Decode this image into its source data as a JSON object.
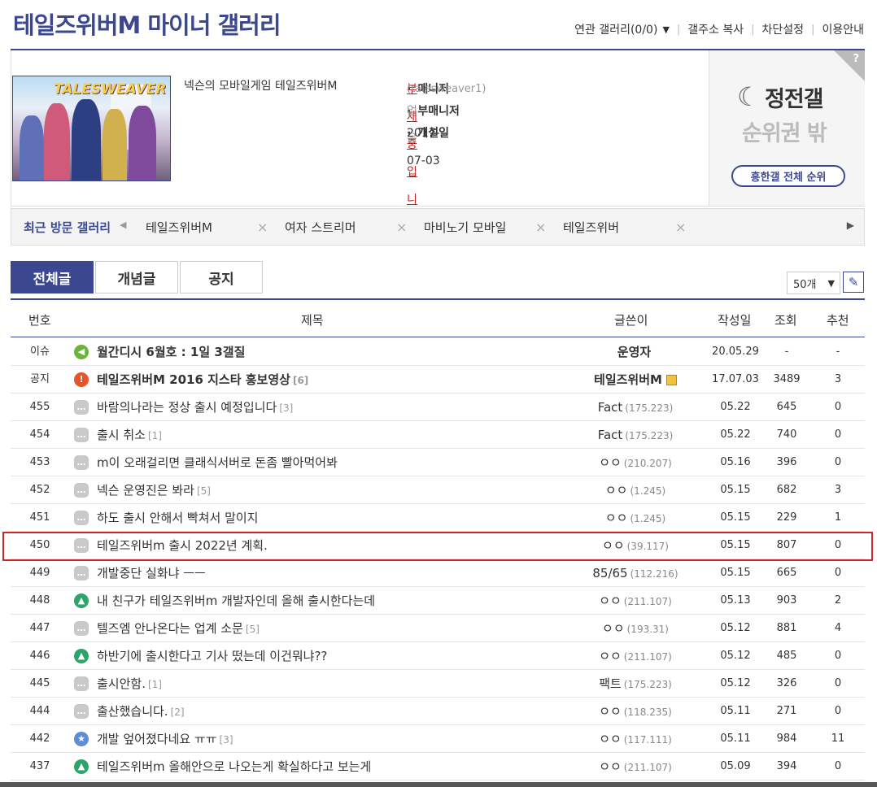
{
  "header": {
    "title": "테일즈위버M 마이너 갤러리",
    "menu": [
      "연관 갤러리(0/0)",
      "갤주소 복사",
      "차단설정",
      "이용안내"
    ]
  },
  "info": {
    "description": "넥슨의 모바일게임 테일즈위버M",
    "thumb_logo": "TALESWEAVER",
    "manager_label": "매니저",
    "manager_value": "부재중입니다",
    "manager_id": "(talesweaver1)",
    "submanager_label": "부매니저",
    "submanager_value": "없음",
    "opened_label": "개설일",
    "opened_value": "2017-07-03"
  },
  "rank": {
    "help": "?",
    "name": "정전갤",
    "status": "순위권 밖",
    "button": "흥한갤 전체 순위"
  },
  "recent": {
    "label": "최근 방문 갤러리",
    "items": [
      "테일즈위버M",
      "여자 스트리머",
      "마비노기 모바일",
      "테일즈위버"
    ]
  },
  "tabs": [
    "전체글",
    "개념글",
    "공지"
  ],
  "perpage": "50개",
  "columns": [
    "번호",
    "제목",
    "글쓴이",
    "작성일",
    "조회",
    "추천"
  ],
  "posts": [
    {
      "num": "이슈",
      "icon": "speaker",
      "title": "월간디시 6월호 : 1일 3갤질",
      "reply": "",
      "writer": "운영자",
      "ip": "",
      "date": "20.05.29",
      "views": "-",
      "rec": "-",
      "bold": true
    },
    {
      "num": "공지",
      "icon": "notice",
      "title": "테일즈위버M 2016 지스타 홍보영상",
      "reply": "[6]",
      "writer": "테일즈위버M",
      "ip": "",
      "date": "17.07.03",
      "views": "3489",
      "rec": "3",
      "bold": true
    },
    {
      "num": "455",
      "icon": "chat",
      "title": "바람의나라는 정상 출시 예정입니다",
      "reply": "[3]",
      "writer": "Fact",
      "ip": "(175.223)",
      "date": "05.22",
      "views": "645",
      "rec": "0"
    },
    {
      "num": "454",
      "icon": "chat",
      "title": "출시 취소",
      "reply": "[1]",
      "writer": "Fact",
      "ip": "(175.223)",
      "date": "05.22",
      "views": "740",
      "rec": "0"
    },
    {
      "num": "453",
      "icon": "chat",
      "title": "m이 오래걸리면 클래식서버로 돈좀 빨아먹어봐",
      "reply": "",
      "writer": "ㅇㅇ",
      "ip": "(210.207)",
      "date": "05.16",
      "views": "396",
      "rec": "0"
    },
    {
      "num": "452",
      "icon": "chat",
      "title": "넥슨 운영진은 봐라",
      "reply": "[5]",
      "writer": "ㅇㅇ",
      "ip": "(1.245)",
      "date": "05.15",
      "views": "682",
      "rec": "3"
    },
    {
      "num": "451",
      "icon": "chat",
      "title": "하도 출시 안해서 빡쳐서 말이지",
      "reply": "",
      "writer": "ㅇㅇ",
      "ip": "(1.245)",
      "date": "05.15",
      "views": "229",
      "rec": "1"
    },
    {
      "num": "450",
      "icon": "chat",
      "title": "테일즈위버m 출시 2022년 계획.",
      "reply": "",
      "writer": "ㅇㅇ",
      "ip": "(39.117)",
      "date": "05.15",
      "views": "807",
      "rec": "0"
    },
    {
      "num": "449",
      "icon": "chat",
      "title": "개발중단 실화냐 ㅡㅡ",
      "reply": "",
      "writer": "85/65",
      "ip": "(112.216)",
      "date": "05.15",
      "views": "665",
      "rec": "0"
    },
    {
      "num": "448",
      "icon": "image",
      "title": "내 친구가 테일즈위버m 개발자인데 올해 출시한다는데",
      "reply": "",
      "writer": "ㅇㅇ",
      "ip": "(211.107)",
      "date": "05.13",
      "views": "903",
      "rec": "2"
    },
    {
      "num": "447",
      "icon": "chat",
      "title": "텔즈엠 안나온다는 업계 소문",
      "reply": "[5]",
      "writer": "ㅇㅇ",
      "ip": "(193.31)",
      "date": "05.12",
      "views": "881",
      "rec": "4"
    },
    {
      "num": "446",
      "icon": "image",
      "title": "하반기에 출시한다고 기사 떴는데 이건뭐냐??",
      "reply": "",
      "writer": "ㅇㅇ",
      "ip": "(211.107)",
      "date": "05.12",
      "views": "485",
      "rec": "0"
    },
    {
      "num": "445",
      "icon": "chat",
      "title": "출시안함.",
      "reply": "[1]",
      "writer": "팩트",
      "ip": "(175.223)",
      "date": "05.12",
      "views": "326",
      "rec": "0"
    },
    {
      "num": "444",
      "icon": "chat",
      "title": "출산했습니다.",
      "reply": "[2]",
      "writer": "ㅇㅇ",
      "ip": "(118.235)",
      "date": "05.11",
      "views": "271",
      "rec": "0"
    },
    {
      "num": "442",
      "icon": "star",
      "title": "개발 엎어졌다네요 ㅠㅠ",
      "reply": "[3]",
      "writer": "ㅇㅇ",
      "ip": "(117.111)",
      "date": "05.11",
      "views": "984",
      "rec": "11"
    },
    {
      "num": "437",
      "icon": "image",
      "title": "테일즈위버m 올해안으로 나오는게 확실하다고 보는게",
      "reply": "",
      "writer": "ㅇㅇ",
      "ip": "(211.107)",
      "date": "05.09",
      "views": "394",
      "rec": "0"
    }
  ]
}
